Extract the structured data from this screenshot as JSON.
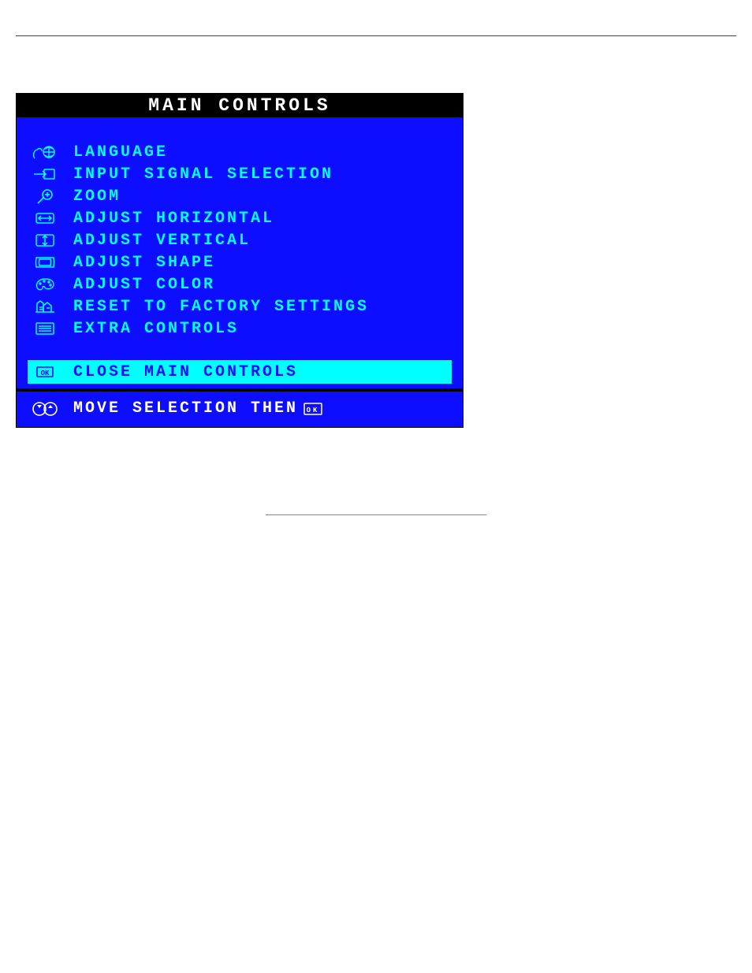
{
  "osd": {
    "title": "MAIN CONTROLS",
    "items": [
      {
        "label": "LANGUAGE",
        "icon": "globe-hand-icon"
      },
      {
        "label": "INPUT SIGNAL SELECTION",
        "icon": "input-arrow-icon"
      },
      {
        "label": "ZOOM",
        "icon": "magnify-icon"
      },
      {
        "label": "ADJUST HORIZONTAL",
        "icon": "horiz-adjust-icon"
      },
      {
        "label": "ADJUST VERTICAL",
        "icon": "vert-adjust-icon"
      },
      {
        "label": "ADJUST SHAPE",
        "icon": "shape-adjust-icon"
      },
      {
        "label": "ADJUST COLOR",
        "icon": "palette-icon"
      },
      {
        "label": "RESET TO FACTORY SETTINGS",
        "icon": "factory-reset-icon"
      },
      {
        "label": "EXTRA CONTROLS",
        "icon": "list-icon"
      }
    ],
    "selected": {
      "label": "CLOSE MAIN CONTROLS",
      "icon": "ok-icon"
    },
    "hint": {
      "text": "MOVE SELECTION THEN",
      "pre_icon": "up-down-icon",
      "post_icon": "ok-icon"
    }
  }
}
